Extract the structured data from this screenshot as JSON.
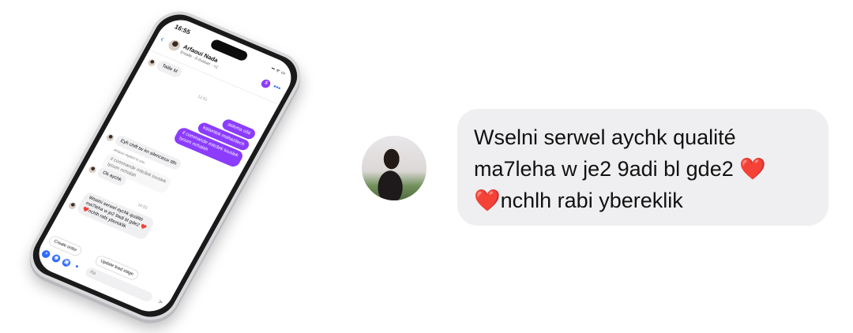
{
  "phone": {
    "status_time": "16:55",
    "status_icons": "▪▪ ᯤ ▭",
    "contact_name": "Arfaoui Nada",
    "contact_sub": "Entalle · À évaluer · +2",
    "badge_icon": "$",
    "messages": {
      "m1": "Taille M",
      "ts1": "12:51",
      "m2": "aslema o5ti",
      "m3": "kalamtek mahazitech",
      "m4": "il commande mte3ek touslek\nlyoum nchalah",
      "m5": "Eyh chift tw kn silencieux tlfn",
      "note": "Arfaoui replied to you",
      "quote": "il commande mte3ek touslek\nlyoum nchalah",
      "m6": "Ok aychk",
      "ts2": "16:55",
      "m7": "Wselni serwel aychk qualité\nma7leha w je2 9adi bl gde2 ❤️\n❤️nchlh rabi ybereklik"
    },
    "quick_actions": [
      "Create order",
      "Update lead stage"
    ],
    "composer_placeholder": "Aa"
  },
  "zoomed_message": {
    "text": "Wselni serwel aychk qualité\nma7leha w je2 9adi bl gde2 ❤️\n❤️nchlh rabi ybereklik"
  },
  "colors": {
    "outgoing_bubble": "#8b3cff",
    "incoming_bubble": "#efeff1",
    "accent": "#2f6bff",
    "heart": "#e8202f"
  }
}
